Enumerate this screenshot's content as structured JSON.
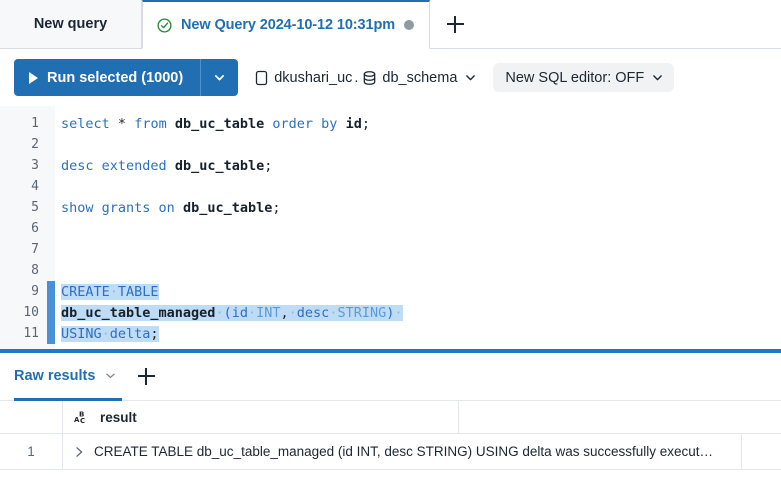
{
  "tabbar": {
    "inactive_tab": {
      "label": "New query"
    },
    "active_tab": {
      "label": "New Query 2024-10-12 10:31pm",
      "status_icon": "check-circle-icon",
      "dirty_icon": "unsaved-dot-icon",
      "accent_color": "#1f6fb2"
    },
    "add_tab": {
      "icon": "plus-icon"
    }
  },
  "toolbar": {
    "run_button": {
      "label": "Run selected  (1000)",
      "icon": "play-icon",
      "color": "#1f6fb2"
    },
    "run_dropdown": {
      "icon": "chevron-down-icon"
    },
    "breadcrumb": {
      "catalog_icon": "catalog-icon",
      "catalog": "dkushari_uc",
      "separator": ".",
      "schema_icon": "database-icon",
      "schema": "db_schema",
      "caret": "chevron-down-icon"
    },
    "sql_editor_toggle": {
      "label": "New SQL editor: OFF",
      "caret": "chevron-down-icon"
    }
  },
  "editor": {
    "lines": [
      {
        "n": "1",
        "selected": false,
        "html": "<span class=\"kw\">select</span> <span class=\"pun\">*</span> <span class=\"kw\">from</span> <span class=\"id\">db_uc_table</span> <span class=\"kw\">order by</span> <span class=\"id\">id</span><span class=\"pun\">;</span>"
      },
      {
        "n": "2",
        "selected": false,
        "html": ""
      },
      {
        "n": "3",
        "selected": false,
        "html": "<span class=\"kw\">desc extended</span> <span class=\"id\">db_uc_table</span><span class=\"pun\">;</span>"
      },
      {
        "n": "4",
        "selected": false,
        "html": ""
      },
      {
        "n": "5",
        "selected": false,
        "html": "<span class=\"kw\">show grants on</span> <span class=\"id\">db_uc_table</span><span class=\"pun\">;</span>"
      },
      {
        "n": "6",
        "selected": false,
        "html": ""
      },
      {
        "n": "7",
        "selected": false,
        "html": ""
      },
      {
        "n": "8",
        "selected": false,
        "html": ""
      },
      {
        "n": "9",
        "selected": true,
        "html": "<span class=\"hl\"><span class=\"kw\">CREATE</span><span class=\"dot\">·</span><span class=\"kw\">TABLE</span></span>"
      },
      {
        "n": "10",
        "selected": true,
        "html": "<span class=\"hl\"><span class=\"id\">db_uc_table_managed</span><span class=\"dot\">·</span><span class=\"kw\">(</span><span class=\"kw\">id</span><span class=\"dot\">·</span><span class=\"type\">INT</span><span class=\"pun\">,</span><span class=\"dot\">·</span><span class=\"kw\">desc</span><span class=\"dot\">·</span><span class=\"type\">STRING</span><span class=\"kw\">)</span><span class=\"dot\">·</span></span>"
      },
      {
        "n": "11",
        "selected": true,
        "html": "<span class=\"hl\"><span class=\"kw\">USING</span><span class=\"dot\">·</span><span class=\"kw\">delta</span><span class=\"pun\">;</span></span>"
      }
    ],
    "plain_text": [
      "select * from db_uc_table order by id;",
      "",
      "desc extended db_uc_table;",
      "",
      "show grants on db_uc_table;",
      "",
      "",
      "",
      "CREATE TABLE",
      "db_uc_table_managed (id INT, desc STRING) ",
      "USING delta;"
    ]
  },
  "results": {
    "tab": {
      "label": "Raw results",
      "caret": "chevron-down-icon"
    },
    "add_tab": {
      "icon": "plus-icon"
    },
    "columns": [
      {
        "name": "result",
        "type_icon": "abc-string-type-icon"
      }
    ],
    "rows": [
      {
        "index": "1",
        "expand_icon": "chevron-right-icon",
        "result": "CREATE TABLE db_uc_table_managed (id INT, desc STRING) USING delta was successfully execut…"
      }
    ]
  }
}
